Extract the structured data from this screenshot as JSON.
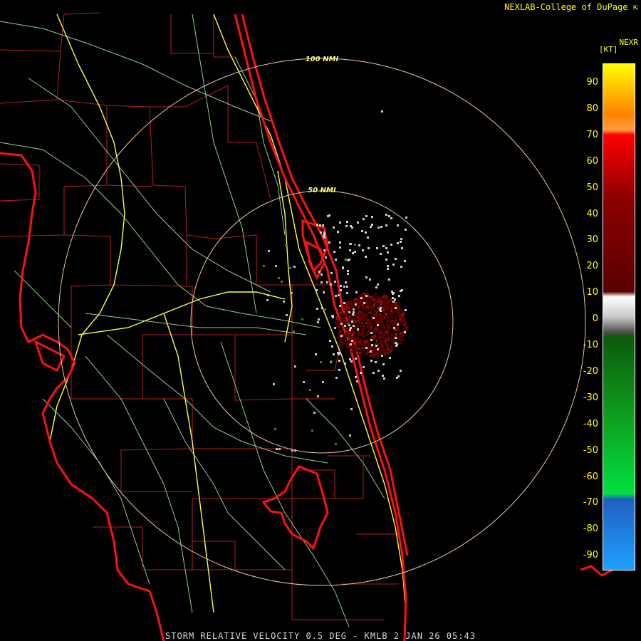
{
  "header": {
    "credit": "NEXLAB-College of DuPage",
    "product": "NEXR",
    "units": "[KT]"
  },
  "footer": {
    "caption": "STORM RELATIVE VELOCITY 0.5 DEG - KMLB 2 JAN 26 05:43"
  },
  "range_rings": [
    {
      "label": "50 NMI"
    },
    {
      "label": "100 NMI"
    }
  ],
  "legend": {
    "ticks": [
      "90",
      "80",
      "70",
      "60",
      "50",
      "40",
      "30",
      "20",
      "10",
      "0",
      "-10",
      "-20",
      "-30",
      "-40",
      "-50",
      "-60",
      "-70",
      "-80",
      "-90"
    ],
    "colors": {
      "high": "#ffff00",
      "orange": "#ff9f40",
      "red": "#ff0000",
      "darkred": "#5a0000",
      "gray": "#c8c8c8",
      "darkgreen": "#0a5a0a",
      "green": "#00e040",
      "blue": "#1f60c0",
      "lightblue": "#1fa0ff"
    }
  },
  "map_colors": {
    "coast": "#ff1010",
    "county": "#b02020",
    "road": "#90d090",
    "interstate": "#ffff40",
    "ring": "#f0c8a0"
  }
}
